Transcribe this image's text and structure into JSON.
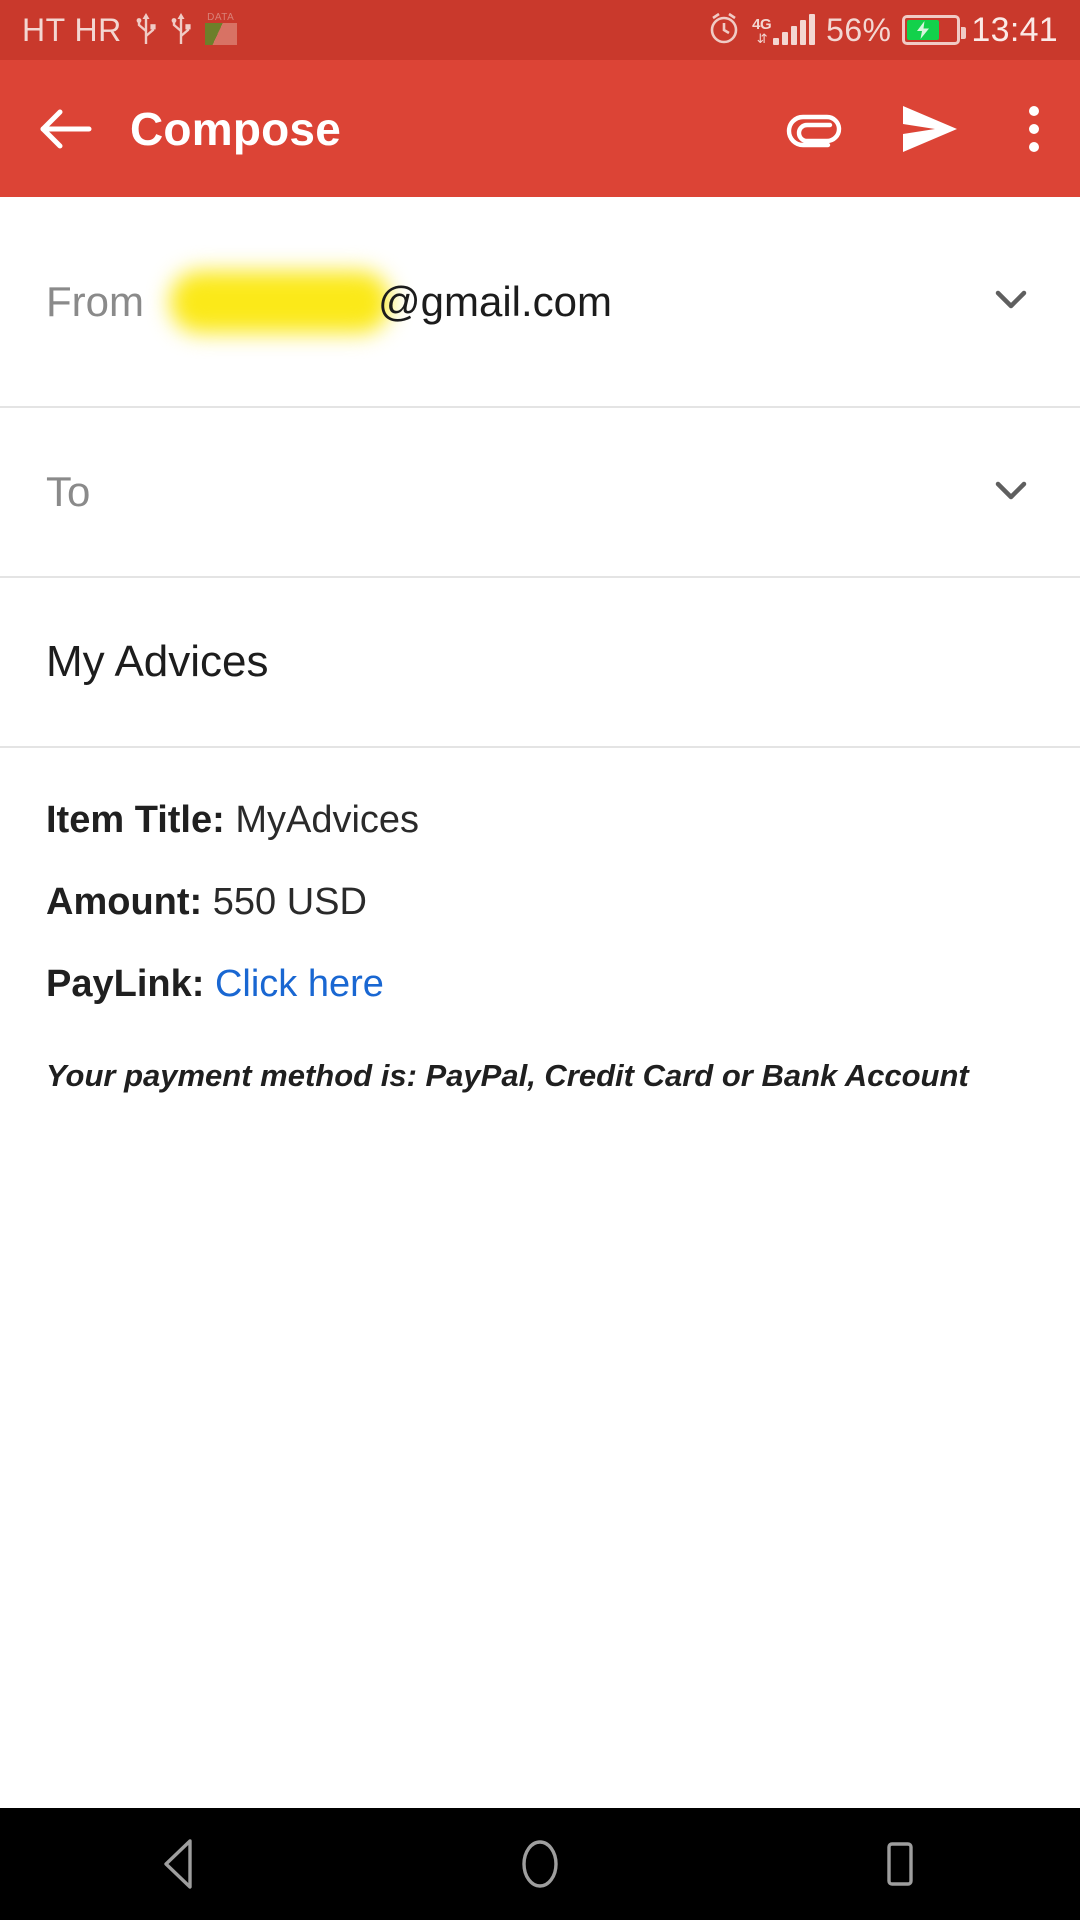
{
  "status_bar": {
    "carrier": "HT HR",
    "usb_icon_1": "usb-icon",
    "usb_icon_2": "usb-icon",
    "data_label": "DATA",
    "alarm_icon": "alarm-icon",
    "network_type": "4G",
    "signal_icon": "signal-bars-icon",
    "battery_percent": "56%",
    "battery_state": "charging",
    "time": "13:41"
  },
  "app_bar": {
    "back_icon": "back-arrow-icon",
    "title": "Compose",
    "attach_icon": "paperclip-icon",
    "send_icon": "send-icon",
    "more_icon": "overflow-menu-icon",
    "background": "#dc4436"
  },
  "compose": {
    "from_label": "From",
    "from_redacted": true,
    "from_domain": "@gmail.com",
    "from_chevron_icon": "chevron-down-icon",
    "to_label": "To",
    "to_value": "",
    "to_chevron_icon": "chevron-down-icon",
    "subject": "My Advices"
  },
  "body": {
    "lines": [
      {
        "label": "Item Title:",
        "value": "MyAdvices",
        "type": "text"
      },
      {
        "label": "Amount:",
        "value": "550 USD",
        "type": "text"
      },
      {
        "label": "PayLink:",
        "value": "Click here",
        "type": "link"
      }
    ],
    "note": "Your payment method is: PayPal, Credit Card or Bank Account",
    "link_color": "#1967d2"
  },
  "nav_bar": {
    "back_icon": "nav-back-triangle-icon",
    "home_icon": "nav-home-circle-icon",
    "recents_icon": "nav-recents-square-icon"
  }
}
